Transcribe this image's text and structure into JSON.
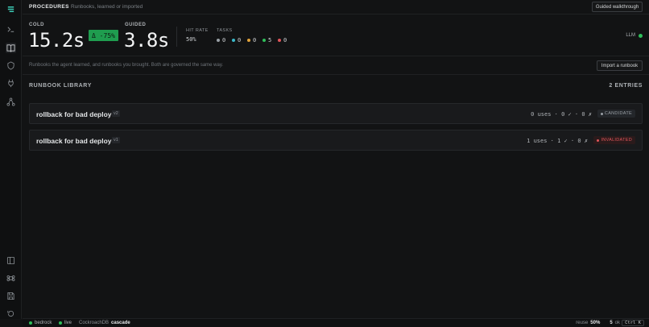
{
  "rail": {
    "icons": [
      "logo-icon",
      "terminal-icon",
      "book-icon",
      "shield-icon",
      "plug-icon",
      "graph-icon",
      "panel-icon",
      "command-icon",
      "save-icon",
      "history-icon"
    ]
  },
  "header": {
    "title": "PROCEDURES",
    "subtitle": "Runbooks, learned or imported",
    "walkthrough_label": "Guided walkthrough"
  },
  "metrics": {
    "cold_label": "COLD",
    "cold_value": "15.2s",
    "delta": "Δ -75%",
    "guided_label": "GUIDED",
    "guided_value": "3.8s",
    "hit_rate_label": "HIT RATE",
    "hit_rate_value": "50%",
    "tasks_label": "TASKS",
    "tasks": [
      {
        "count": "0",
        "color": "#9aa0a6"
      },
      {
        "count": "0",
        "color": "#3bb8c9"
      },
      {
        "count": "0",
        "color": "#e0a23a"
      },
      {
        "count": "5",
        "color": "#2fbf5a"
      },
      {
        "count": "0",
        "color": "#e0555a"
      }
    ],
    "llm_label": "LLM",
    "llm_color": "#2fbf5a"
  },
  "info": {
    "text": "Runbooks the agent learned, and runbooks you brought. Both are governed the same way.",
    "import_label": "Import a runbook"
  },
  "library": {
    "title": "RUNBOOK LIBRARY",
    "count": "2 ENTRIES",
    "entries": [
      {
        "name": "rollback for bad deploy",
        "version": "v2",
        "stats": "0 uses · 0 ✓ · 0 ✗",
        "status": "CANDIDATE"
      },
      {
        "name": "rollback for bad deploy",
        "version": "v1",
        "stats": "1 uses · 1 ✓ · 0 ✗",
        "status": "INVALIDATED"
      }
    ]
  },
  "footer": {
    "bedrock": "bedrock",
    "live": "live",
    "db_label": "CockroachDB",
    "db_name": "cascade",
    "reuse_label": "reuse",
    "reuse_value": "50%",
    "ok_count": "5",
    "ok_label": "ok",
    "shortcut": "Ctrl K"
  }
}
